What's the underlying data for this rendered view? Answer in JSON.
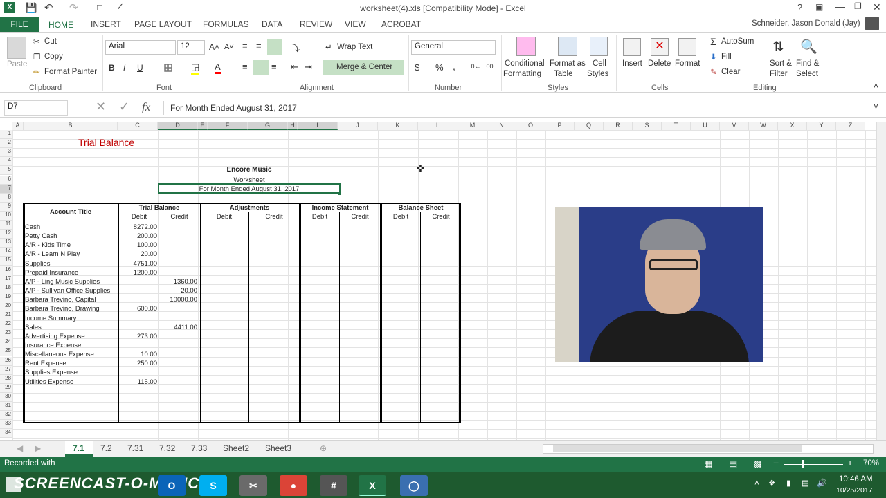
{
  "window": {
    "title": "worksheet(4).xls  [Compatibility Mode] - Excel",
    "user": "Schneider, Jason Donald (Jay)"
  },
  "ribbon_tabs": [
    "FILE",
    "HOME",
    "INSERT",
    "PAGE LAYOUT",
    "FORMULAS",
    "DATA",
    "REVIEW",
    "VIEW",
    "ACROBAT"
  ],
  "clipboard": {
    "paste": "Paste",
    "cut": "Cut",
    "copy": "Copy",
    "format_painter": "Format Painter",
    "label": "Clipboard"
  },
  "font": {
    "name": "Arial",
    "size": "12",
    "bold": "B",
    "italic": "I",
    "underline": "U",
    "label": "Font"
  },
  "alignment": {
    "wrap": "Wrap Text",
    "merge": "Merge & Center",
    "label": "Alignment"
  },
  "number": {
    "format": "General",
    "dollar": "$",
    "percent": "%",
    "comma": ",",
    "label": "Number"
  },
  "styles": {
    "conditional": "Conditional",
    "conditional2": "Formatting",
    "format_as": "Format as",
    "format_as2": "Table",
    "cell": "Cell",
    "cell2": "Styles",
    "label": "Styles"
  },
  "cells": {
    "insert": "Insert",
    "delete": "Delete",
    "format": "Format",
    "label": "Cells"
  },
  "editing": {
    "autosum": "AutoSum",
    "fill": "Fill",
    "clear": "Clear",
    "sort": "Sort &",
    "sort2": "Filter",
    "find": "Find &",
    "find2": "Select",
    "label": "Editing"
  },
  "formula_bar": {
    "name_box": "D7",
    "fx": "fx",
    "formula": "For Month Ended August 31, 2017"
  },
  "columns": [
    "A",
    "B",
    "C",
    "D",
    "E",
    "F",
    "G",
    "H",
    "I",
    "J",
    "K",
    "L",
    "M",
    "N",
    "O",
    "P",
    "Q",
    "R",
    "S",
    "T",
    "U",
    "V",
    "W",
    "X",
    "Y",
    "Z"
  ],
  "rows": [
    "1",
    "2",
    "3",
    "4",
    "5",
    "6",
    "7",
    "8",
    "9",
    "10",
    "11",
    "12",
    "13",
    "14",
    "15",
    "16",
    "17",
    "18",
    "19",
    "20",
    "21",
    "22",
    "23",
    "24",
    "25",
    "26",
    "27",
    "28",
    "29",
    "30",
    "31",
    "32",
    "33",
    "34"
  ],
  "sheet": {
    "title_cell": "Trial Balance",
    "company": "Encore Music",
    "doc": "Worksheet",
    "period": "For Month Ended August 31, 2017",
    "headers": {
      "account": "Account Title",
      "tb": "Trial Balance",
      "adj": "Adjustments",
      "is": "Income Statement",
      "bs": "Balance Sheet",
      "debit": "Debit",
      "credit": "Credit"
    },
    "accounts": [
      {
        "name": "Cash",
        "debit": "8272.00",
        "credit": ""
      },
      {
        "name": "Petty Cash",
        "debit": "200.00",
        "credit": ""
      },
      {
        "name": "A/R - Kids Time",
        "debit": "100.00",
        "credit": ""
      },
      {
        "name": "A/R - Learn N Play",
        "debit": "20.00",
        "credit": ""
      },
      {
        "name": "Supplies",
        "debit": "4751.00",
        "credit": ""
      },
      {
        "name": "Prepaid Insurance",
        "debit": "1200.00",
        "credit": ""
      },
      {
        "name": "A/P - Ling Music Supplies",
        "debit": "",
        "credit": "1360.00"
      },
      {
        "name": "A/P - Sullivan Office Supplies",
        "debit": "",
        "credit": "20.00"
      },
      {
        "name": "Barbara Trevino, Capital",
        "debit": "",
        "credit": "10000.00"
      },
      {
        "name": "Barbara Trevino, Drawing",
        "debit": "600.00",
        "credit": ""
      },
      {
        "name": "Income Summary",
        "debit": "",
        "credit": ""
      },
      {
        "name": "Sales",
        "debit": "",
        "credit": "4411.00"
      },
      {
        "name": "Advertising Expense",
        "debit": "273.00",
        "credit": ""
      },
      {
        "name": "Insurance Expense",
        "debit": "",
        "credit": ""
      },
      {
        "name": "Miscellaneous Expense",
        "debit": "10.00",
        "credit": ""
      },
      {
        "name": "Rent Expense",
        "debit": "250.00",
        "credit": ""
      },
      {
        "name": "Supplies Expense",
        "debit": "",
        "credit": ""
      },
      {
        "name": "Utilities Expense",
        "debit": "115.00",
        "credit": ""
      }
    ]
  },
  "sheet_tabs": [
    "7.1",
    "7.2",
    "7.31",
    "7.32",
    "7.33",
    "Sheet2",
    "Sheet3"
  ],
  "status": {
    "recorded": "Recorded with",
    "zoom": "70%",
    "brand": "SCREENCAST-O-MATIC"
  },
  "taskbar": {
    "time": "10:46 AM",
    "date": "10/25/2017"
  },
  "colors": {
    "excel_green": "#217346",
    "title_red": "#c00000"
  }
}
